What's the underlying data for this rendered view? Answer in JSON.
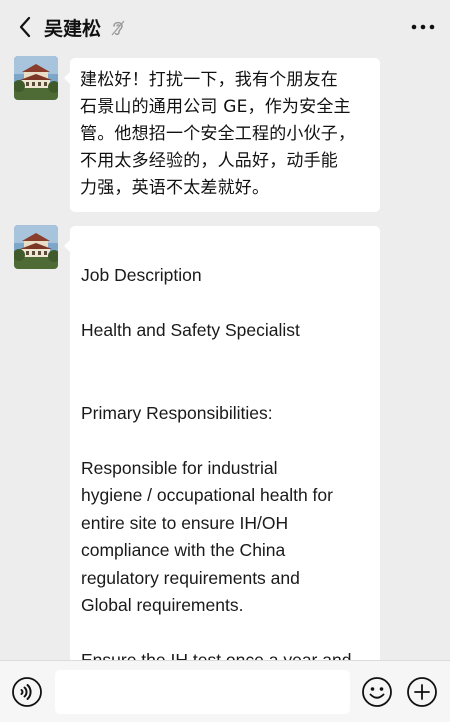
{
  "header": {
    "title": "吴建松",
    "back_icon": "chevron-left-icon",
    "earpiece_icon": "ear-icon",
    "more_icon": "more-dots-icon"
  },
  "messages": [
    {
      "sender_avatar": "building-photo-avatar",
      "lines": [
        "建松好！打扰一下，我有个朋友在",
        "石景山的通用公司 GE，作为安全主",
        "管。他想招一个安全工程的小伙子，",
        "不用太多经验的，人品好，动手能",
        "力强，英语不太差就好。"
      ]
    },
    {
      "sender_avatar": "building-photo-avatar",
      "heading": "Job Description",
      "job_title": "Health and Safety Specialist",
      "section": "Primary Responsibilities:",
      "body_lines": [
        "Responsible for industrial",
        "hygiene / occupational health for",
        "entire site to ensure IH/OH",
        "compliance with the China",
        "regulatory requirements and",
        "Global requirements."
      ],
      "cut_line": "Ensure the IH test once a year and"
    }
  ],
  "bottom_bar": {
    "voice_icon": "voice-icon",
    "input_value": "",
    "emoji_icon": "emoji-icon",
    "plus_icon": "plus-icon"
  },
  "colors": {
    "background": "#ededed",
    "bubble": "#ffffff",
    "bar": "#f6f6f6"
  }
}
